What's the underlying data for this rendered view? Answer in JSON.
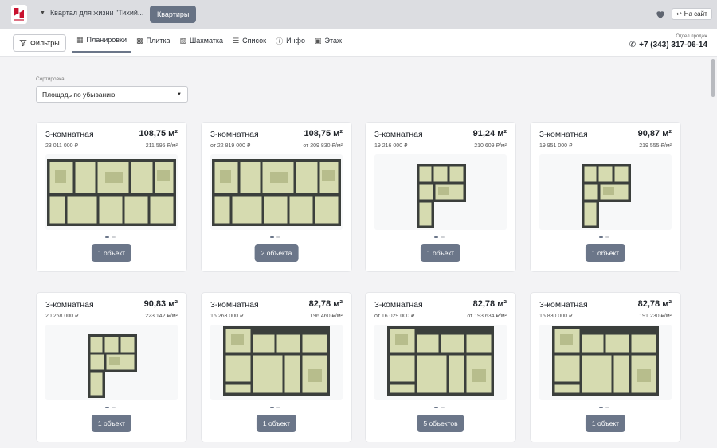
{
  "topbar": {
    "project": "Квартал для жизни \"Тихий...",
    "apartments_button": "Квартиры",
    "site_button": "На сайт",
    "logo_icon": "developer-logo",
    "brand_color": "#c8102e"
  },
  "nav": {
    "filters": "Фильтры",
    "tabs": [
      {
        "label": "Планировки",
        "icon": "layout-icon"
      },
      {
        "label": "Плитка",
        "icon": "grid-icon"
      },
      {
        "label": "Шахматка",
        "icon": "chess-icon"
      },
      {
        "label": "Список",
        "icon": "list-icon"
      },
      {
        "label": "Инфо",
        "icon": "info-icon"
      },
      {
        "label": "Этаж",
        "icon": "floor-icon"
      }
    ],
    "sales_label": "Отдел продаж",
    "phone": "+7 (343) 317-06-14"
  },
  "sort": {
    "label": "Сортировка",
    "value": "Площадь по убыванию"
  },
  "cards": [
    {
      "title": "3-комнатная",
      "area": "108,75 м²",
      "price": "23 011 000 ₽",
      "ppm": "211 595 ₽/м²",
      "button": "1 объект",
      "plan": "wide"
    },
    {
      "title": "3-комнатная",
      "area": "108,75 м²",
      "price": "от 22 819 000 ₽",
      "ppm": "от 209 830 ₽/м²",
      "button": "2 объекта",
      "plan": "wide"
    },
    {
      "title": "3-комнатная",
      "area": "91,24 м²",
      "price": "19 216 000 ₽",
      "ppm": "210 609 ₽/м²",
      "button": "1 объект",
      "plan": "narrow"
    },
    {
      "title": "3-комнатная",
      "area": "90,87 м²",
      "price": "19 951 000 ₽",
      "ppm": "219 555 ₽/м²",
      "button": "1 объект",
      "plan": "narrow"
    },
    {
      "title": "3-комнатная",
      "area": "90,83 м²",
      "price": "20 268 000 ₽",
      "ppm": "223 142 ₽/м²",
      "button": "1 объект",
      "plan": "narrow"
    },
    {
      "title": "3-комнатная",
      "area": "82,78 м²",
      "price": "16 263 000 ₽",
      "ppm": "196 460 ₽/м²",
      "button": "1 объект",
      "plan": "mid"
    },
    {
      "title": "3-комнатная",
      "area": "82,78 м²",
      "price": "от 16 029 000 ₽",
      "ppm": "от 193 634 ₽/м²",
      "button": "5 объектов",
      "plan": "mid"
    },
    {
      "title": "3-комнатная",
      "area": "82,78 м²",
      "price": "15 830 000 ₽",
      "ppm": "191 230 ₽/м²",
      "button": "1 объект",
      "plan": "mid"
    }
  ]
}
